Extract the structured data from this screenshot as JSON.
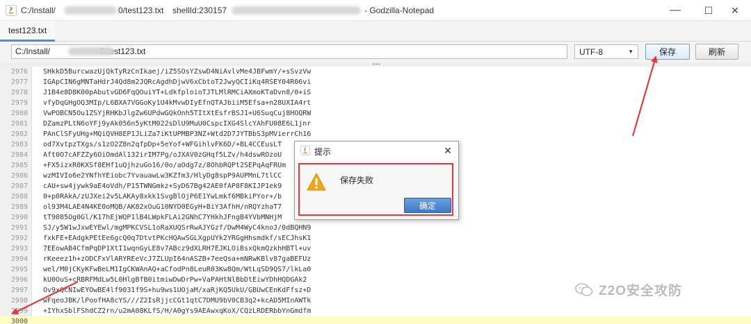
{
  "window": {
    "title_path_prefix": "C:/Install/",
    "title_path_suffix": "0/test123.txt",
    "title_shell": "shellId:230157",
    "title_app": "- Godzilla-Notepad",
    "minimize": "—",
    "maximize": "☐",
    "close": "✕"
  },
  "tab": {
    "label": "test123.txt"
  },
  "toolbar": {
    "path_prefix": "C:/Install/",
    "path_suffix": "0/test123.txt",
    "encoding": "UTF-8",
    "save_label": "保存",
    "refresh_label": "刷新"
  },
  "editor": {
    "lines": [
      {
        "n": "2976",
        "text": "SHkkD5BurcwazUjQkTyRzCnIkaej/iZ5SOsYZswD4NiAvlvMe4JBFwmY/+sSvzVw"
      },
      {
        "n": "2977",
        "text": "IGApCIN6gMNTaHdrJ4Qd8m2JQRcAgdhDjwV6xCbtoT2JwyQCIiKq4RSEY04R06vi"
      },
      {
        "n": "2978",
        "text": "J1B4e8D8K00pAbutvGD6FqQOuiYT+LdkfploioTJTLMlRMCiAXmoKTaDvn8/0+iS"
      },
      {
        "n": "2979",
        "text": "vfyDqGHgOQ3MIp/L6BXA7VGGoKy1U4kMvwDIyEfnQTAJbiiM5Efsa+n28UXIA4rt"
      },
      {
        "n": "2980",
        "text": "VwPOBCN5Ou1ZSYjRHKbJlgZw6UPdwGQkOnh5TItXtEsfrBSJ1+U6SuqCuj8HOQRW"
      },
      {
        "n": "2981",
        "text": "DZamzPLtN6oYFj9yAk056n5yKtM022sDlU9MuU0CspcIXG4SlcYAhFU08E6L1jnr"
      },
      {
        "n": "2982",
        "text": "PAnClSFyUHg+MQiQVH8EP1JLiZa7iKtUPMBP3NZ+Wtd2D7JYTBbS3pMVierrCh16"
      },
      {
        "n": "2983",
        "text": "od7XvtpzTXgs/s1zO2Z8n2qfpDp+5eYof+WFGihlvFK6D/+BL4CCEusLT"
      },
      {
        "n": "2984",
        "text": "Aft0O7cAFZZy6OiOmdAl132irIM7Pg/oJXAV0zGHqf5LZv/h4dswROzoU"
      },
      {
        "n": "2985",
        "text": "+FX5izxR0KXSf8EHf1uQjhzuGo16/0o/aOdg7z/8OhbRQPt2SEPqAqFRUm"
      },
      {
        "n": "2986",
        "text": "wzMIVIo6e2YNfhYEiobc7YvauawLw3KZfm3/HlyDg8spP9AUPMnL7tlCC"
      },
      {
        "n": "2987",
        "text": "cAU+sw4jywk9aE4oVdh/P15TWNGmkz+SyD67Bg42AE0fAP8F8KIJP1ek9"
      },
      {
        "n": "2988",
        "text": "0+p0RAkA/zUJXei2v5LAKAy8xkk1SvgBlOjP6E1YwLmkf6MBkiPYor+/b"
      },
      {
        "n": "2989",
        "text": "ol93M4LAE4N4KE0oMQB/AK82xOuG10NYD0EGyH+BiY3AfhH/nRQYzhaT7"
      },
      {
        "n": "2990",
        "text": "tT9085Og0Gl/K17hEjWQP1lB4LWpkFLAi2GNhC7YHkhJFngB4YVbMNHjM"
      },
      {
        "n": "2991",
        "text": "SJ/y5W1wJxwEYEwl/mgMPKCVSL1oRaXUQSrRwAJYGzf/DwM4WyC4knoJ/0dBQHN9"
      },
      {
        "n": "2992",
        "text": "fxkFE+EAdgkPEtEe6gcQ0q7DtvtPKcHQAwSGLXgpUYk2YRGgHhsmdkf/sECJhsK1"
      },
      {
        "n": "2993",
        "text": "7EEowAB4CfmPqDP1XtI1wqnGyLE8v7ABcz9dXLRH7EJKLOiBsxQkmQzkhHBTl+uv"
      },
      {
        "n": "2994",
        "text": "rKeeez1h+zODCFxVlARYREeVcJ7ZLUpI64nASZB+7eeQsa+mNRwKBlv87gaBEFUz"
      },
      {
        "n": "2995",
        "text": "wel/M0jCKyKFwBeLM1IgCKWAnAQ+aCfodPn8LeuR03Kw8Qm/WtLqSD9QS7/lkLa0"
      },
      {
        "n": "2996",
        "text": "kU0OuS+cRBRFMdLw5L0HlgBfB0itmiwDwDrPw+VaPAHtNlBbDtEiwYDhHQDGAk2"
      },
      {
        "n": "2997",
        "text": "Ov9xQcNIwEYOwBE4lf9031f9S+hu9ws1UOjaM/xaRjKQ5UkU/GBUwCEnKdFfsz+D"
      },
      {
        "n": "2998",
        "text": "wFqeoJBK/lPoofHA8cYS///Z2IsRjjcCGt1qtC7DMU9bV0CB3q2+kcAD5MInAWTk"
      },
      {
        "n": "2999",
        "text": "+IYhxSblFShdCZ2rn/u2mA08KLfS/H/A0gYs9AEAwxqKoX/CQzLRDERbbYnGmdfm"
      },
      {
        "n": "3000",
        "text": ""
      }
    ]
  },
  "dialog": {
    "title": "提示",
    "message": "保存失败",
    "ok_label": "确定",
    "close": "✕"
  },
  "watermark": {
    "text": "Z2O安全攻防"
  },
  "colors": {
    "annotation_red": "#e0393e",
    "accent_blue": "#4a90d9",
    "current_line": "#fdfdc4"
  }
}
